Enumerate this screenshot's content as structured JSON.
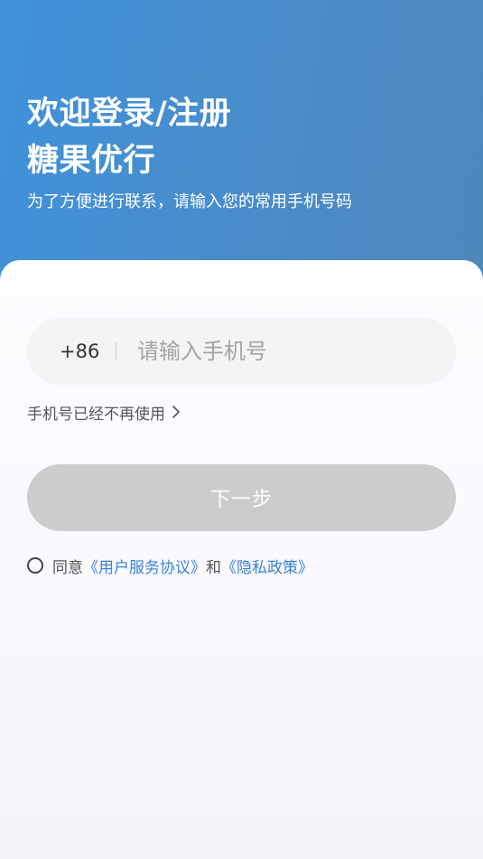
{
  "header": {
    "title_line1": "欢迎登录/注册",
    "title_line2": "糖果优行",
    "subtitle": "为了方便进行联系，请输入您的常用手机号码"
  },
  "phone": {
    "country_code": "+86",
    "placeholder": "请输入手机号",
    "value": ""
  },
  "no_longer_used": {
    "label": "手机号已经不再使用",
    "icon": "chevron-right-icon"
  },
  "next_button": {
    "label": "下一步",
    "enabled": false
  },
  "agreement": {
    "checked": false,
    "prefix": "同意",
    "user_agreement": "《用户服务协议》",
    "conjunction": "和",
    "privacy_policy": "《隐私政策》"
  },
  "colors": {
    "header_start": "#3f92dc",
    "header_end": "#4d88bc",
    "link": "#3a84d0",
    "button_disabled": "#cccccc"
  }
}
